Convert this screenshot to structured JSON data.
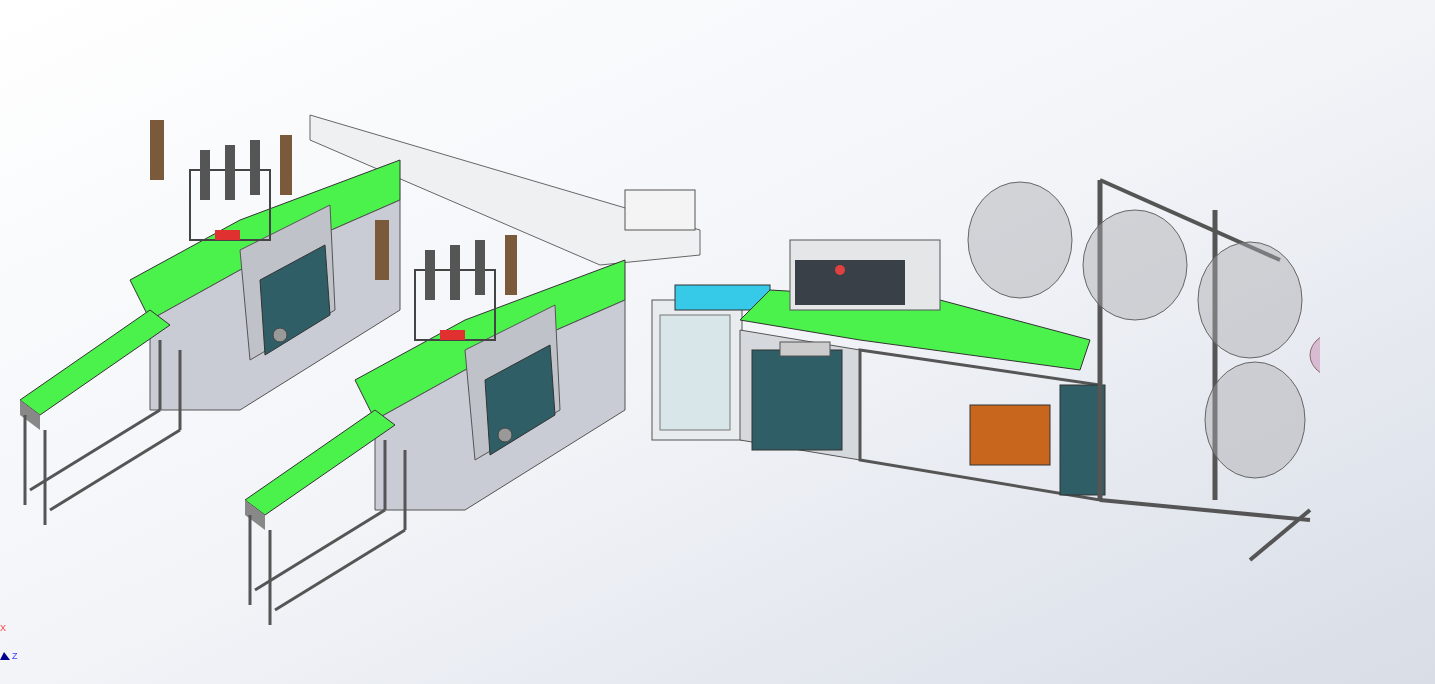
{
  "viewport": {
    "triad": {
      "x_label": "X",
      "z_label": "Z"
    }
  }
}
